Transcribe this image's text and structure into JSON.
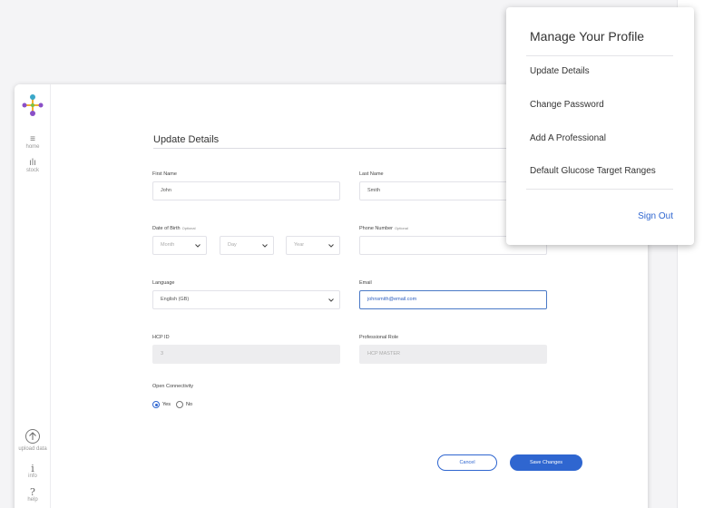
{
  "sidebar": {
    "items": [
      {
        "label": "home",
        "icon": "home-icon"
      },
      {
        "label": "stock",
        "icon": "stock-icon"
      }
    ],
    "bottom": [
      {
        "label": "upload data",
        "icon": "upload-icon"
      },
      {
        "label": "info",
        "icon": "info-icon"
      },
      {
        "label": "help",
        "icon": "help-icon"
      }
    ]
  },
  "form": {
    "title": "Update Details",
    "first_name": {
      "label": "First Name",
      "value": "John"
    },
    "last_name": {
      "label": "Last Name",
      "value": "Smith"
    },
    "dob": {
      "label": "Date of Birth",
      "optional": "Optional",
      "month": "Month",
      "day": "Day",
      "year": "Year"
    },
    "phone": {
      "label": "Phone Number",
      "optional": "Optional",
      "value": ""
    },
    "language": {
      "label": "Language",
      "value": "English (GB)"
    },
    "email": {
      "label": "Email",
      "value": "johnsmith@email.com"
    },
    "hcp_id": {
      "label": "HCP ID",
      "value": "3"
    },
    "role": {
      "label": "Professional Role",
      "value": "HCP MASTER"
    },
    "connectivity": {
      "label": "Open Connectivity",
      "yes": "Yes",
      "no": "No",
      "selected": "Yes"
    },
    "cancel": "Cancel",
    "save": "Save Changes"
  },
  "menu": {
    "title": "Manage Your Profile",
    "items": [
      "Update Details",
      "Change Password",
      "Add A Professional",
      "Default Glucose Target Ranges"
    ],
    "signout": "Sign Out"
  },
  "colors": {
    "accent": "#2f66d0",
    "logo_teal": "#3aa7c9",
    "logo_purple": "#8a4fc7",
    "logo_green": "#7dc143"
  }
}
